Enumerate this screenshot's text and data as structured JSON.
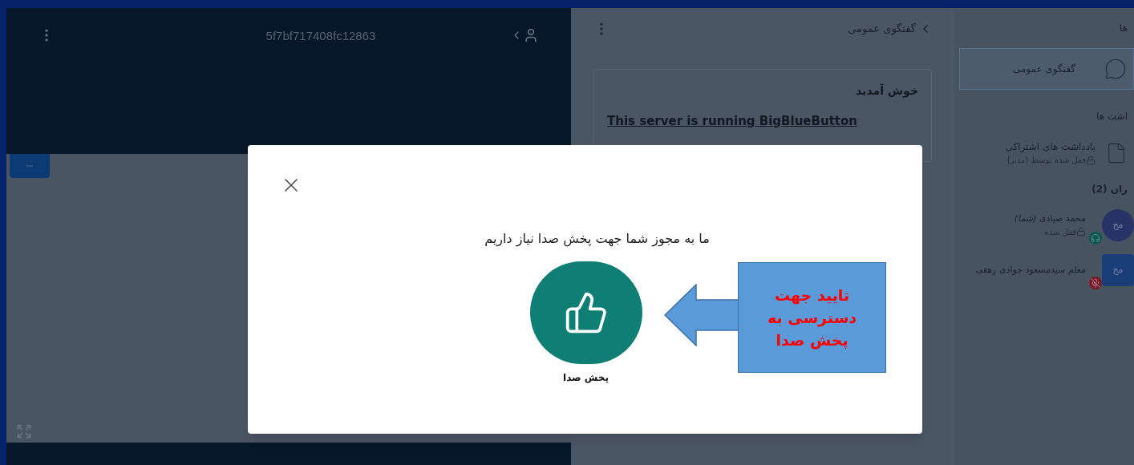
{
  "presentation": {
    "title": "5f7bf717408fc12863"
  },
  "chat": {
    "title": "گفتگوی عمومی",
    "messages": [
      {
        "sender": "خوش آمدید",
        "text": "This server is running BigBlueButton"
      }
    ]
  },
  "user_list": {
    "messages_heading": "ها",
    "chat_items": [
      {
        "label": "گفتگوی عمومی",
        "selected": true
      }
    ],
    "notes_heading": "اشت ها",
    "notes": [
      {
        "title": "یادداشت های اشتراکی",
        "status": "قفل شده توسط (مدیر)"
      }
    ],
    "users_heading": "ران (2)",
    "users": [
      {
        "initials": "مح",
        "name": "محمد صیادی",
        "you_label": "(شما)",
        "status": "قفل شده",
        "moderator": false,
        "kind": "listen"
      },
      {
        "initials": "مح",
        "name": "معلم سیدمسعود جوادی رهقی",
        "moderator": true,
        "kind": "muted"
      }
    ]
  },
  "modal": {
    "message": "ما به مجوز شما جهت پخش صدا نیاز داریم",
    "options": [
      {
        "label": "پخش صدا"
      }
    ]
  },
  "annotation": {
    "text": "تایید جهت دسترسی به پخش صدا"
  }
}
